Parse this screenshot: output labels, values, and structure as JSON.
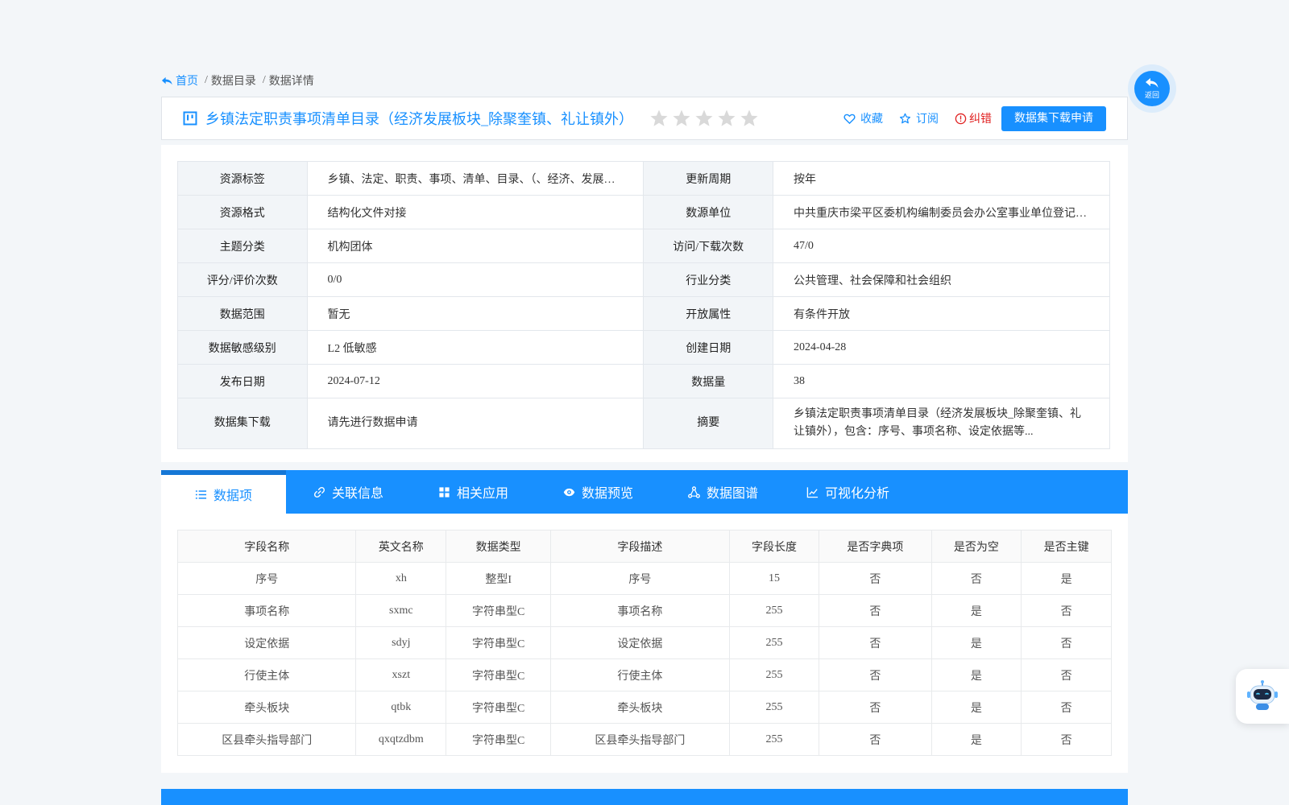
{
  "breadcrumb": {
    "home": "首页",
    "items": [
      "数据目录",
      "数据详情"
    ]
  },
  "header": {
    "title": "乡镇法定职责事项清单目录（经济发展板块_除聚奎镇、礼让镇外）",
    "rating": 0,
    "max_rating": 5,
    "favorite": "收藏",
    "subscribe": "订阅",
    "report_error": "纠错",
    "apply_button": "数据集下载申请"
  },
  "info": {
    "rows": [
      {
        "k1": "资源标签",
        "v1": "乡镇、法定、职责、事项、清单、目录、（、经济、发展…",
        "k2": "更新周期",
        "v2": "按年"
      },
      {
        "k1": "资源格式",
        "v1": "结构化文件对接",
        "k2": "数源单位",
        "v2": "中共重庆市梁平区委机构编制委员会办公室事业单位登记…"
      },
      {
        "k1": "主题分类",
        "v1": "机构团体",
        "k2": "访问/下载次数",
        "v2": "47/0"
      },
      {
        "k1": "评分/评价次数",
        "v1": "0/0",
        "k2": "行业分类",
        "v2": "公共管理、社会保障和社会组织"
      },
      {
        "k1": "数据范围",
        "v1": "暂无",
        "k2": "开放属性",
        "v2": "有条件开放"
      },
      {
        "k1": "数据敏感级别",
        "v1": "L2 低敏感",
        "k2": "创建日期",
        "v2": "2024-04-28"
      },
      {
        "k1": "发布日期",
        "v1": "2024-07-12",
        "k2": "数据量",
        "v2": "38"
      },
      {
        "k1": "数据集下载",
        "v1": "请先进行数据申请",
        "k2": "摘要",
        "v2": "乡镇法定职责事项清单目录（经济发展板块_除聚奎镇、礼让镇外），包含：序号、事项名称、设定依据等..."
      }
    ]
  },
  "tabs": [
    {
      "label": "数据项",
      "icon": "list-icon"
    },
    {
      "label": "关联信息",
      "icon": "link-icon"
    },
    {
      "label": "相关应用",
      "icon": "grid-icon"
    },
    {
      "label": "数据预览",
      "icon": "eye-icon"
    },
    {
      "label": "数据图谱",
      "icon": "graph-icon"
    },
    {
      "label": "可视化分析",
      "icon": "line-chart-icon"
    }
  ],
  "fields_table": {
    "headers": [
      "字段名称",
      "英文名称",
      "数据类型",
      "字段描述",
      "字段长度",
      "是否字典项",
      "是否为空",
      "是否主键"
    ],
    "rows": [
      [
        "序号",
        "xh",
        "整型I",
        "序号",
        "15",
        "否",
        "否",
        "是"
      ],
      [
        "事项名称",
        "sxmc",
        "字符串型C",
        "事项名称",
        "255",
        "否",
        "是",
        "否"
      ],
      [
        "设定依据",
        "sdyj",
        "字符串型C",
        "设定依据",
        "255",
        "否",
        "是",
        "否"
      ],
      [
        "行使主体",
        "xszt",
        "字符串型C",
        "行使主体",
        "255",
        "否",
        "是",
        "否"
      ],
      [
        "牵头板块",
        "qtbk",
        "字符串型C",
        "牵头板块",
        "255",
        "否",
        "是",
        "否"
      ],
      [
        "区县牵头指导部门",
        "qxqtzdbm",
        "字符串型C",
        "区县牵头指导部门",
        "255",
        "否",
        "是",
        "否"
      ]
    ]
  },
  "back": {
    "label": "返回"
  },
  "colors": {
    "primary": "#1890ff",
    "error": "#e02020",
    "star_empty": "#d9d9d9"
  }
}
